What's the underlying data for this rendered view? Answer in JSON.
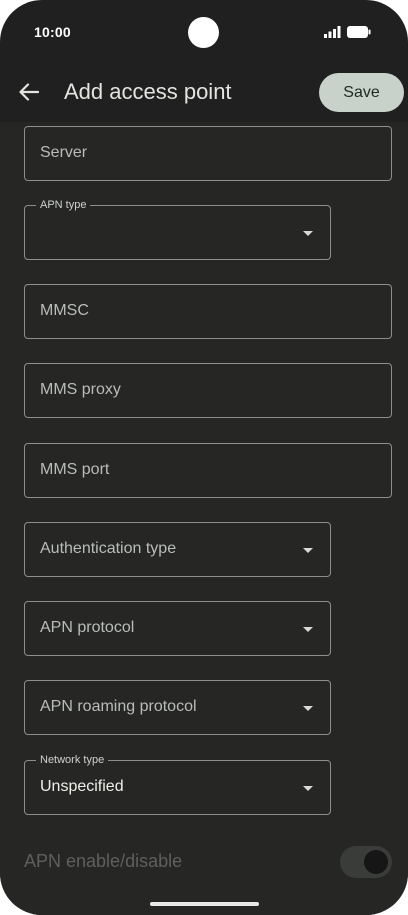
{
  "status_bar": {
    "time": "10:00",
    "icons": [
      "front-camera",
      "signal-icon",
      "battery-icon"
    ]
  },
  "app_bar": {
    "back_icon": "arrow-back",
    "title": "Add access point",
    "save_label": "Save"
  },
  "fields": {
    "server": {
      "placeholder": "Server"
    },
    "apn_type": {
      "label": "APN type",
      "value": ""
    },
    "mmsc": {
      "placeholder": "MMSC"
    },
    "mms_proxy": {
      "placeholder": "MMS proxy"
    },
    "mms_port": {
      "placeholder": "MMS port"
    },
    "auth_type": {
      "placeholder": "Authentication type"
    },
    "apn_protocol": {
      "placeholder": "APN protocol"
    },
    "apn_roaming_protocol": {
      "placeholder": "APN roaming protocol"
    },
    "network_type": {
      "label": "Network type",
      "value": "Unspecified"
    }
  },
  "apn_toggle": {
    "label": "APN enable/disable",
    "state": "on",
    "enabled": false
  },
  "colors": {
    "background": "#1f201f",
    "content_background": "#262725",
    "save_button": "#c8d2ca",
    "field_border": "#8c8f8b"
  }
}
